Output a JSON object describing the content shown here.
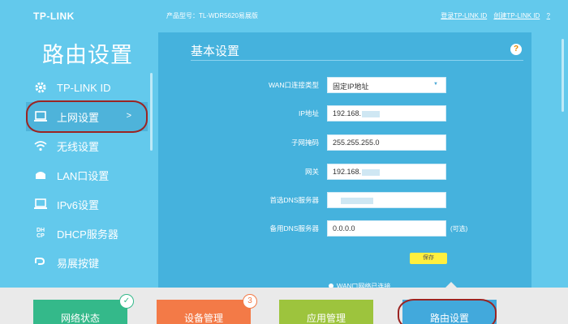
{
  "brand": "TP-LINK",
  "sidebar": {
    "title": "路由设置",
    "items": [
      {
        "label": "TP-LINK ID",
        "icon": "gear-icon"
      },
      {
        "label": "上网设置",
        "icon": "laptop-icon",
        "arrow": ">",
        "active": true
      },
      {
        "label": "无线设置",
        "icon": "wifi-icon"
      },
      {
        "label": "LAN口设置",
        "icon": "lan-icon"
      },
      {
        "label": "IPv6设置",
        "icon": "monitor-icon"
      },
      {
        "label": "DHCP服务器",
        "icon": "dhcp-icon"
      },
      {
        "label": "易展按键",
        "icon": "easymesh-icon"
      }
    ]
  },
  "header": {
    "model_label": "产品型号：TL-WDR5620易展版",
    "links": [
      "登录TP-LINK ID",
      "创建TP-LINK ID"
    ],
    "help": "?"
  },
  "panel": {
    "title": "基本设置",
    "help_icon": "?",
    "fields": [
      {
        "label": "WAN口连接类型",
        "value": "固定IP地址",
        "type": "select"
      },
      {
        "label": "IP地址",
        "value": "192.168.",
        "masked": true
      },
      {
        "label": "子网掩码",
        "value": "255.255.255.0"
      },
      {
        "label": "网关",
        "value": "192.168.",
        "masked": true
      },
      {
        "label": "首选DNS服务器",
        "value": "",
        "masked": true
      },
      {
        "label": "备用DNS服务器",
        "value": "0.0.0.0",
        "hint": "(可选)"
      }
    ],
    "save_label": "保存",
    "radio_label": "WAN口网络已连接"
  },
  "bottom": {
    "tiles": [
      {
        "label": "网络状态",
        "color": "#34b98a",
        "badge": "✓"
      },
      {
        "label": "设备管理",
        "color": "#f37a47",
        "badge": "3"
      },
      {
        "label": "应用管理",
        "color": "#9dc43d"
      },
      {
        "label": "路由设置",
        "color": "#42a9dc",
        "active": true
      }
    ]
  },
  "colors": {
    "sidebar_bg": "#63c9ec",
    "panel_bg": "#45b2dd",
    "highlight_ring": "#9b2422",
    "save_button": "#ffef3e"
  }
}
